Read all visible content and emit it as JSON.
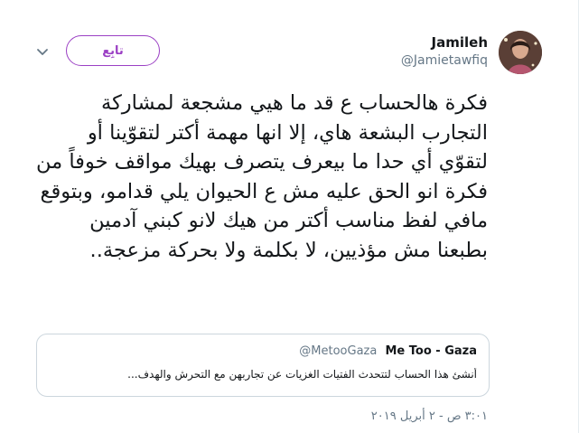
{
  "tweet": {
    "author": {
      "display_name": "Jamileh",
      "handle": "@Jamietawfiq",
      "avatar_icon": "profile-photo"
    },
    "follow_label": "تابِع",
    "menu_icon": "chevron-down-icon",
    "text": "فكرة هالحساب ع قد ما هيي مشجعة لمشاركة التجارب البشعة هاي، إلا انها مهمة أكتر لتقوّينا أو لتقوّي أي حدا ما بيعرف يتصرف بهيك مواقف خوفاً من فكرة انو الحق عليه مش ع الحيوان يلي قدامو، وبتوقع مافي لفظ مناسب أكتر من هيك لانو كبني آدمين بطبعنا مش مؤذيين، لا بكلمة ولا بحركة مزعجة..",
    "quoted": {
      "name": "Me Too - Gaza",
      "handle": "@MetooGaza",
      "text": "أنشئ هذا الحساب لتتحدث الفتيات الغزيات عن تجاربهن مع التحرش والهدف..."
    },
    "timestamp": "٣:٠١ ص - ٢ أبريل ٢٠١٩"
  },
  "colors": {
    "accent": "#9b40c4",
    "secondary_text": "#657786",
    "border": "#ccd6dd"
  }
}
